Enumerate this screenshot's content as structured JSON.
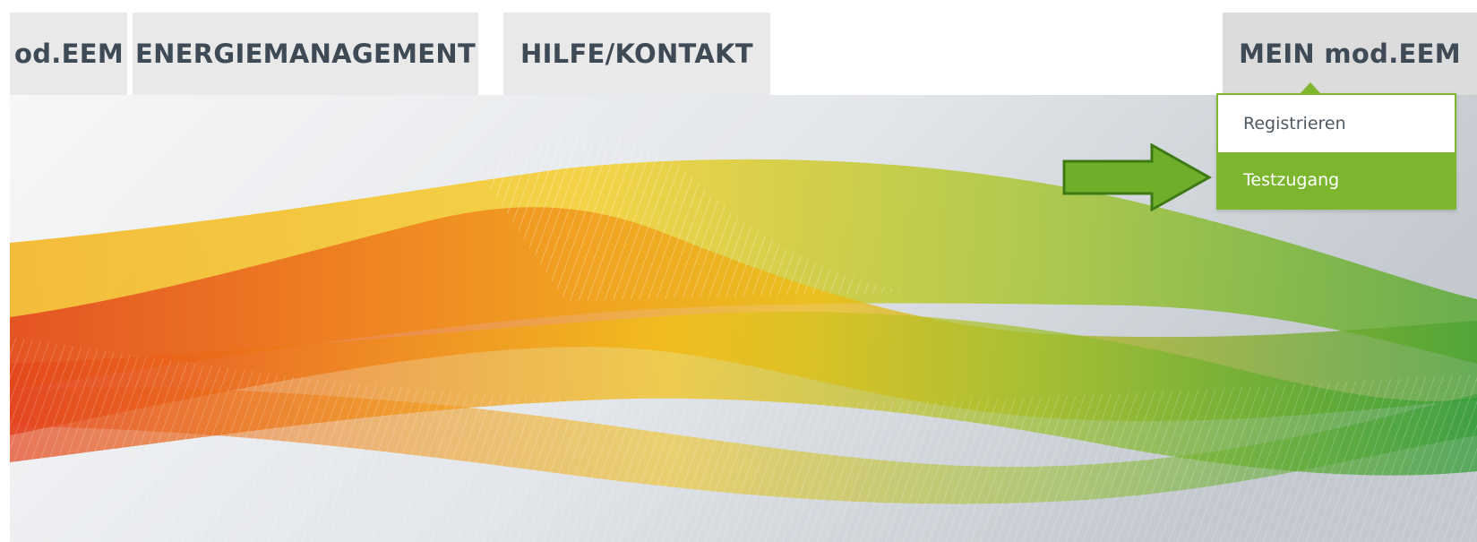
{
  "nav": {
    "tabs": [
      {
        "label": "od.EEM"
      },
      {
        "label": "ENERGIEMANAGEMENT"
      },
      {
        "label": "HILFE/KONTAKT"
      }
    ],
    "account_tab": {
      "label": "MEIN mod.EEM"
    }
  },
  "dropdown": {
    "items": [
      {
        "label": "Registrieren"
      },
      {
        "label": "Testzugang"
      }
    ]
  },
  "colors": {
    "accent_green": "#7cb52e",
    "tab_bg": "#e9e9e9",
    "tab_text": "#3e4a55"
  },
  "annotation": {
    "icon": "arrow-right-icon"
  }
}
